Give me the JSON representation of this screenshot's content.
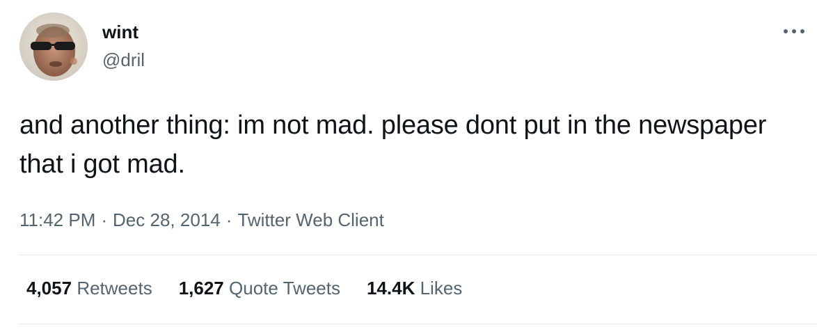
{
  "author": {
    "display_name": "wint",
    "handle": "@dril"
  },
  "tweet": {
    "text": "and another thing: im not mad. please dont put in the newspaper that i got mad.",
    "time": "11:42 PM",
    "date": "Dec 28, 2014",
    "source": "Twitter Web Client",
    "separator": "·"
  },
  "stats": {
    "retweets": {
      "count": "4,057",
      "label": "Retweets"
    },
    "quote_tweets": {
      "count": "1,627",
      "label": "Quote Tweets"
    },
    "likes": {
      "count": "14.4K",
      "label": "Likes"
    }
  },
  "icons": {
    "more": "more-options-icon"
  },
  "colors": {
    "text_primary": "#0f1419",
    "text_secondary": "#536471",
    "divider": "#e6ecf0"
  }
}
